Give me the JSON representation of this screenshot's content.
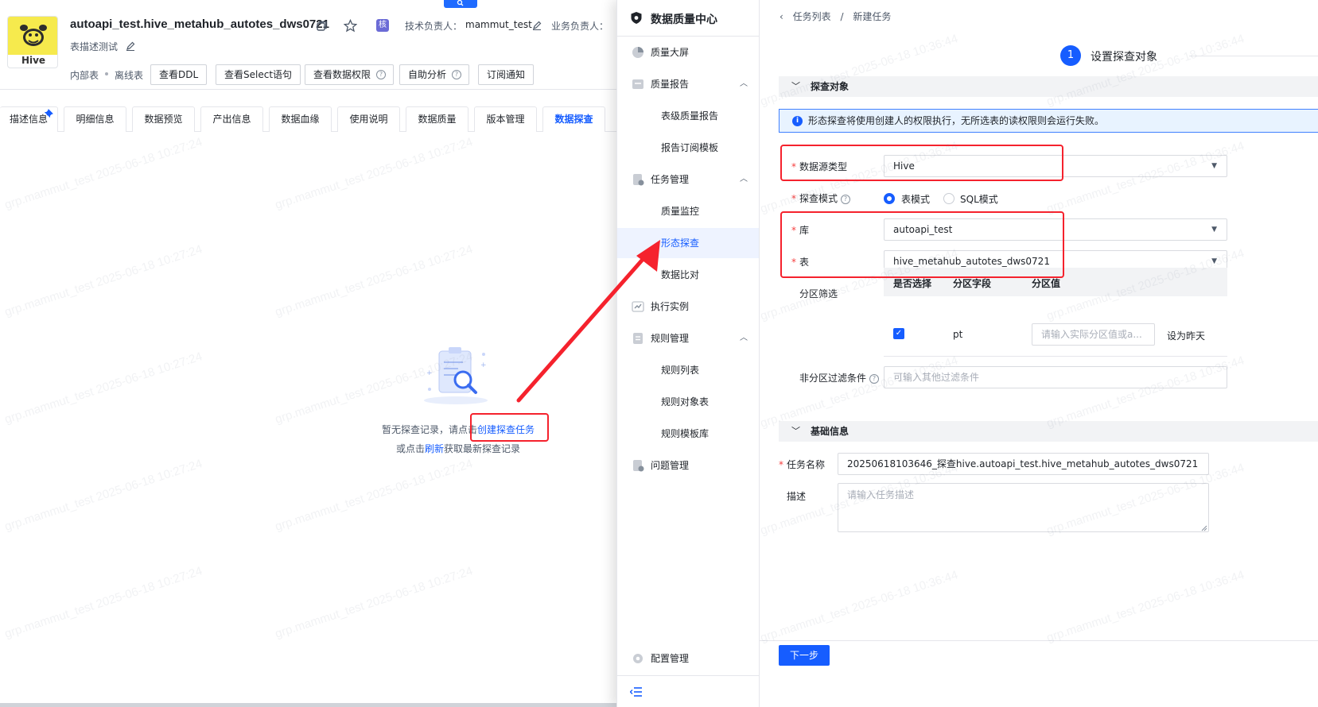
{
  "left": {
    "logo_label": "Hive",
    "table_title": "autoapi_test.hive_metahub_autotes_dws0721",
    "badge": "核",
    "tech_owner_label": "技术负责人：",
    "tech_owner_value": "mammut_test",
    "biz_owner_label": "业务负责人：",
    "description": "表描述测试",
    "tag_internal": "内部表",
    "tag_offline": "离线表",
    "buttons": [
      "查看DDL",
      "查看Select语句",
      "查看数据权限",
      "自助分析",
      "订阅通知"
    ],
    "tabs": [
      "描述信息",
      "明细信息",
      "数据预览",
      "产出信息",
      "数据血缘",
      "使用说明",
      "数据质量",
      "版本管理",
      "数据探查"
    ],
    "active_tab": "数据探查",
    "empty_line1_prefix": "暂无探查记录，请点击",
    "empty_line1_link": "创建探查任务",
    "empty_line2_prefix": "或点击",
    "empty_line2_link": "刷新",
    "empty_line2_suffix": "获取最新探查记录",
    "watermark": "grp.mammut_test 2025-06-18 10:27:24"
  },
  "sidebar": {
    "title": "数据质量中心",
    "items": [
      {
        "label": "质量大屏",
        "icon": "pie-chart-icon"
      },
      {
        "label": "质量报告",
        "icon": "report-icon",
        "expanded": true
      },
      {
        "label": "表级质量报告",
        "sub": true
      },
      {
        "label": "报告订阅模板",
        "sub": true
      },
      {
        "label": "任务管理",
        "icon": "task-icon",
        "expanded": true
      },
      {
        "label": "质量监控",
        "sub": true
      },
      {
        "label": "形态探查",
        "sub": true,
        "active": true
      },
      {
        "label": "数据比对",
        "sub": true
      },
      {
        "label": "执行实例",
        "icon": "instance-icon"
      },
      {
        "label": "规则管理",
        "icon": "rule-icon",
        "expanded": true
      },
      {
        "label": "规则列表",
        "sub": true
      },
      {
        "label": "规则对象表",
        "sub": true
      },
      {
        "label": "规则模板库",
        "sub": true
      },
      {
        "label": "问题管理",
        "icon": "issue-icon"
      }
    ],
    "config": "配置管理"
  },
  "form": {
    "breadcrumb_1": "任务列表",
    "breadcrumb_sep": "/",
    "breadcrumb_2": "新建任务",
    "step_number": "1",
    "step_label": "设置探查对象",
    "section1": "探查对象",
    "alert": "形态探查将使用创建人的权限执行，无所选表的读权限则会运行失败。",
    "datasource_label": "数据源类型",
    "datasource_value": "Hive",
    "mode_label": "探查模式",
    "mode_table": "表模式",
    "mode_sql": "SQL模式",
    "db_label": "库",
    "db_value": "autoapi_test",
    "table_label": "表",
    "table_value": "hive_metahub_autotes_dws0721",
    "partition_label": "分区筛选",
    "partition_headers": [
      "是否选择",
      "分区字段",
      "分区值"
    ],
    "partition_field": "pt",
    "partition_placeholder": "请输入实际分区值或a...",
    "set_yesterday": "设为昨天",
    "filter_label": "非分区过滤条件",
    "filter_placeholder": "可输入其他过滤条件",
    "section2": "基础信息",
    "taskname_label": "任务名称",
    "taskname_value": "20250618103646_探查hive.autoapi_test.hive_metahub_autotes_dws0721",
    "desc_label": "描述",
    "desc_placeholder": "请输入任务描述",
    "next_button": "下一步",
    "watermark": "grp.mammut_test 2025-06-18 10:36:44"
  }
}
